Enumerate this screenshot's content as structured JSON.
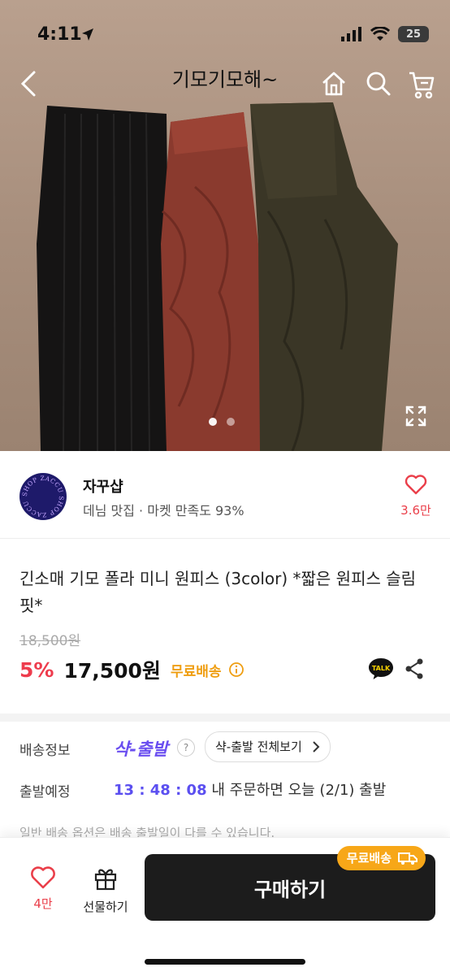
{
  "status_bar": {
    "time": "4:11",
    "battery": "25"
  },
  "nav": {
    "title": "기모기모해~"
  },
  "gallery": {
    "page_count": 2,
    "current_index": 0
  },
  "shop": {
    "name": "자꾸샵",
    "subtitle": "데님 맛집 · 마켓 만족도 93%",
    "like_count": "3.6만",
    "logo_text": "SHOP ZACCU SHOP ZACCU"
  },
  "product": {
    "title": "긴소매 기모 폴라 미니 원피스 (3color) *짧은 원피스 슬림 핏*",
    "original_price": "18,500원",
    "discount": "5%",
    "price": "17,500원",
    "free_shipping": "무료배송",
    "talk_label": "TALK"
  },
  "delivery": {
    "label": "배송정보",
    "shak_logo": "샥-출발",
    "help": "?",
    "shak_all_button": "샥-출발 전체보기",
    "departure_label": "출발예정",
    "countdown": "13 : 48 : 08",
    "departure_text": "내 주문하면 오늘 (2/1) 출발",
    "note": "일반 배송 옵션은 배송 출발일이 다를 수 있습니다."
  },
  "bottom_bar": {
    "like_count": "4만",
    "gift_label": "선물하기",
    "buy_label": "구매하기",
    "ship_badge": "무료배송"
  },
  "colors": {
    "accent_red": "#ea3f4a",
    "shak_purple": "#6a4ef0",
    "badge_orange": "#f7a718",
    "buy_button": "#1c1c1c"
  }
}
